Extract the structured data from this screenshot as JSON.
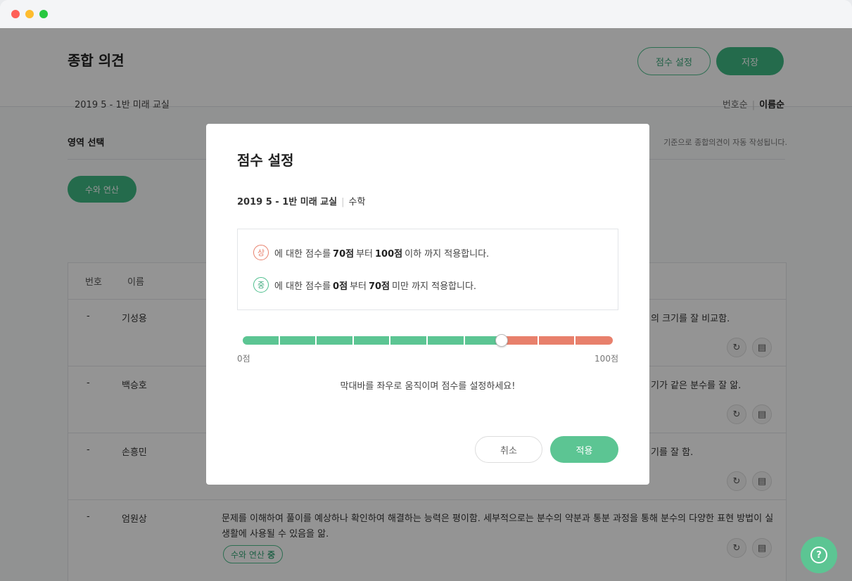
{
  "window": {
    "traffic_lights": [
      "close",
      "minimize",
      "zoom"
    ]
  },
  "header": {
    "title": "종합 의견",
    "score_setting_label": "점수 설정",
    "save_label": "저장"
  },
  "filters": {
    "class_name": "2019 5 - 1반 미래 교실",
    "sort_by_number": "번호순",
    "sort_by_name": "이름순",
    "area_select_label": "영역 선택",
    "auto_note": "기준으로 종합의견이 자동 작성됩니다.",
    "area_chip": "수와 연산"
  },
  "table": {
    "columns": {
      "number": "번호",
      "name": "이름"
    },
    "rows": [
      {
        "number": "-",
        "name": "기성용",
        "opinion": "의 크기를 잘 비교함."
      },
      {
        "number": "-",
        "name": "백승호",
        "opinion": "기가 같은 분수를 잘 앎."
      },
      {
        "number": "-",
        "name": "손흥민",
        "opinion": "기를 잘 함."
      },
      {
        "number": "-",
        "name": "엄원상",
        "opinion": "문제를 이해하여 풀이를 예상하나 확인하여 해결하는 능력은 평이함. 세부적으로는 분수의 약분과 통분 과정을 통해 분수의 다양한 표현 방법이 실생활에 사용될 수 있음을 앎.",
        "tag_area": "수와 연산",
        "tag_level": "중"
      }
    ],
    "icons": [
      "refresh-icon",
      "save-icon"
    ]
  },
  "modal": {
    "title": "점수 설정",
    "class_name": "2019 5 - 1반 미래 교실",
    "subject": "수학",
    "rules": [
      {
        "level": "상",
        "prefix": "에 대한 점수를",
        "from": "70점",
        "mid": "부터",
        "to": "100점",
        "suffix": "이하 까지 적용합니다."
      },
      {
        "level": "중",
        "prefix": "에 대한 점수를",
        "from": "0점",
        "mid": "부터",
        "to": "70점",
        "suffix": "미만 까지 적용합니다."
      }
    ],
    "slider": {
      "min_label": "0점",
      "max_label": "100점",
      "value": 70,
      "min": 0,
      "max": 100,
      "segments": 10,
      "low_color": "#5cc593",
      "high_color": "#e8806c"
    },
    "hint": "막대바를 좌우로 움직이며 점수를 설정하세요!",
    "cancel_label": "취소",
    "apply_label": "적용"
  },
  "help": {
    "icon": "question-icon",
    "glyph": "?"
  }
}
